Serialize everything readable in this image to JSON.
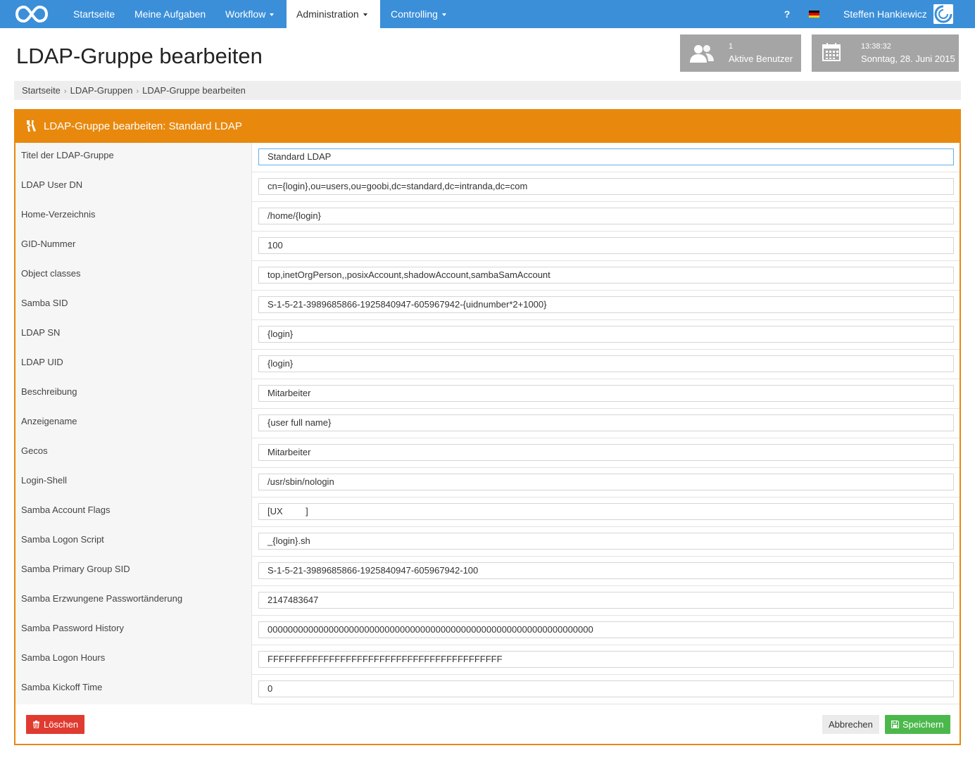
{
  "colors": {
    "nav_bg": "#3b8fd9",
    "panel_accent": "#e8890e",
    "delete": "#e03b30",
    "save": "#4cb84c",
    "stat_box": "#a5a5a5"
  },
  "nav": {
    "items": [
      {
        "label": "Startseite"
      },
      {
        "label": "Meine Aufgaben"
      },
      {
        "label": "Workflow"
      },
      {
        "label": "Administration"
      },
      {
        "label": "Controlling"
      }
    ],
    "help": "?",
    "language_icon": "german-flag-icon",
    "user_name": "Steffen Hankiewicz"
  },
  "header": {
    "title": "LDAP-Gruppe bearbeiten",
    "active_users": {
      "count": "1",
      "label": "Aktive Benutzer"
    },
    "clock": {
      "time": "13:38:32",
      "date": "Sonntag, 28. Juni 2015"
    }
  },
  "breadcrumb": [
    "Startseite",
    "LDAP-Gruppen",
    "LDAP-Gruppe bearbeiten"
  ],
  "panel": {
    "title": "LDAP-Gruppe bearbeiten: Standard LDAP",
    "fields": [
      {
        "label": "Titel der LDAP-Gruppe",
        "value": "Standard LDAP"
      },
      {
        "label": "LDAP User DN",
        "value": "cn={login},ou=users,ou=goobi,dc=standard,dc=intranda,dc=com"
      },
      {
        "label": "Home-Verzeichnis",
        "value": "/home/{login}"
      },
      {
        "label": "GID-Nummer",
        "value": "100"
      },
      {
        "label": "Object classes",
        "value": "top,inetOrgPerson,,posixAccount,shadowAccount,sambaSamAccount"
      },
      {
        "label": "Samba SID",
        "value": "S-1-5-21-3989685866-1925840947-605967942-{uidnumber*2+1000}"
      },
      {
        "label": "LDAP SN",
        "value": "{login}"
      },
      {
        "label": "LDAP UID",
        "value": "{login}"
      },
      {
        "label": "Beschreibung",
        "value": "Mitarbeiter"
      },
      {
        "label": "Anzeigename",
        "value": "{user full name}"
      },
      {
        "label": "Gecos",
        "value": "Mitarbeiter"
      },
      {
        "label": "Login-Shell",
        "value": "/usr/sbin/nologin"
      },
      {
        "label": "Samba Account Flags",
        "value": "[UX         ]"
      },
      {
        "label": "Samba Logon Script",
        "value": "_{login}.sh"
      },
      {
        "label": "Samba Primary Group SID",
        "value": "S-1-5-21-3989685866-1925840947-605967942-100"
      },
      {
        "label": "Samba Erzwungene Passwortänderung",
        "value": "2147483647"
      },
      {
        "label": "Samba Password History",
        "value": "0000000000000000000000000000000000000000000000000000000000000000"
      },
      {
        "label": "Samba Logon Hours",
        "value": "FFFFFFFFFFFFFFFFFFFFFFFFFFFFFFFFFFFFFFFFFF"
      },
      {
        "label": "Samba Kickoff Time",
        "value": "0"
      }
    ],
    "buttons": {
      "delete": "Löschen",
      "cancel": "Abbrechen",
      "save": "Speichern"
    }
  }
}
